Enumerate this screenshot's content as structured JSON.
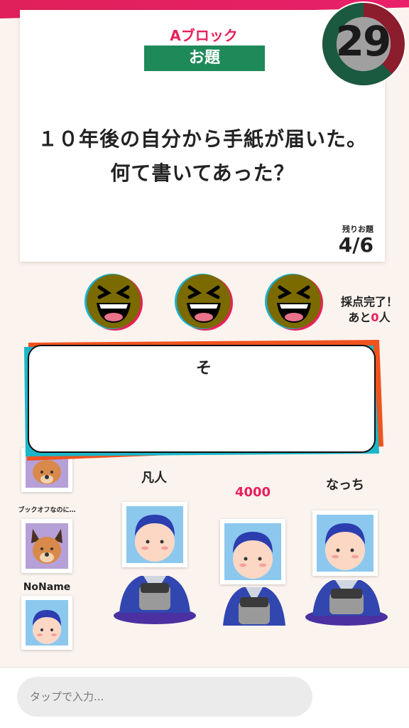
{
  "topic": {
    "block_label": "Aブロック",
    "badge_label": "お題",
    "question_line1": "１０年後の自分から手紙が届いた。",
    "question_line2": "何て書いてあった？",
    "remaining_label": "残りお題",
    "remaining_value": "4/6"
  },
  "timer": {
    "value": "29",
    "remaining_fraction": 0.62
  },
  "reactions": [
    {
      "icon": "laughing-face-icon"
    },
    {
      "icon": "laughing-face-icon"
    },
    {
      "icon": "laughing-face-icon"
    }
  ],
  "scoring": {
    "line1": "採点完了！",
    "line2_prefix": "あと",
    "line2_count": "0",
    "line2_suffix": "人"
  },
  "answer": {
    "text": "そ"
  },
  "side_players": [
    {
      "name": "ブックオフなのに…",
      "avatar": "dog-avatar-icon"
    },
    {
      "name": "NoName",
      "avatar": "boy-avatar-icon"
    }
  ],
  "stage_players": [
    {
      "name": "凡人",
      "avatar": "boy-avatar-icon"
    },
    {
      "name": "4000",
      "avatar": "boy-avatar-icon"
    },
    {
      "name": "なっち",
      "avatar": "boy-avatar-icon"
    }
  ],
  "input": {
    "placeholder": "タップで入力..."
  },
  "colors": {
    "accent": "#e8205a",
    "badge": "#1e8a5a",
    "timer_ring": "#1a5a40",
    "timer_elapsed": "#8b1d2c"
  }
}
